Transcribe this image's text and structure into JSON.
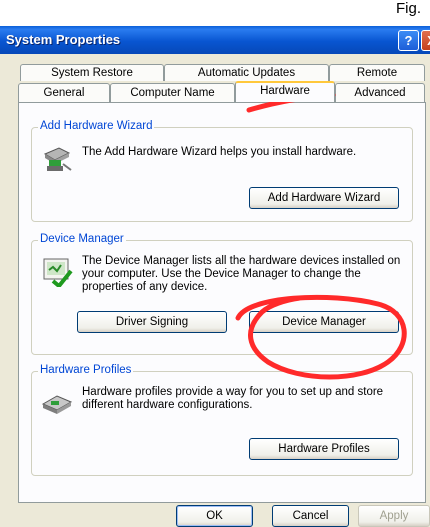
{
  "figure_label": "Fig.",
  "window": {
    "title": "System Properties",
    "help_glyph": "?",
    "close_glyph": "X"
  },
  "tabs_row1": [
    {
      "label": "System Restore"
    },
    {
      "label": "Automatic Updates"
    },
    {
      "label": "Remote"
    }
  ],
  "tabs_row2": [
    {
      "label": "General"
    },
    {
      "label": "Computer Name"
    },
    {
      "label": "Hardware",
      "active": true
    },
    {
      "label": "Advanced"
    }
  ],
  "add_hardware": {
    "title": "Add Hardware Wizard",
    "description": "The Add Hardware Wizard helps you install hardware.",
    "button": "Add Hardware Wizard",
    "icon": "add-hardware-wizard-icon"
  },
  "device_manager": {
    "title": "Device Manager",
    "description": "The Device Manager lists all the hardware devices installed on your computer. Use the Device Manager to change the properties of any device.",
    "driver_signing_button": "Driver Signing",
    "device_manager_button": "Device Manager",
    "icon": "device-manager-icon"
  },
  "hardware_profiles": {
    "title": "Hardware Profiles",
    "description": "Hardware profiles provide a way for you to set up and store different hardware configurations.",
    "button": "Hardware Profiles",
    "icon": "hardware-profiles-icon"
  },
  "footer": {
    "ok": "OK",
    "cancel": "Cancel",
    "apply": "Apply"
  },
  "colors": {
    "accent": "#0046d5",
    "annotation": "#ff2a2a",
    "active_tab": "#ffc83c"
  }
}
